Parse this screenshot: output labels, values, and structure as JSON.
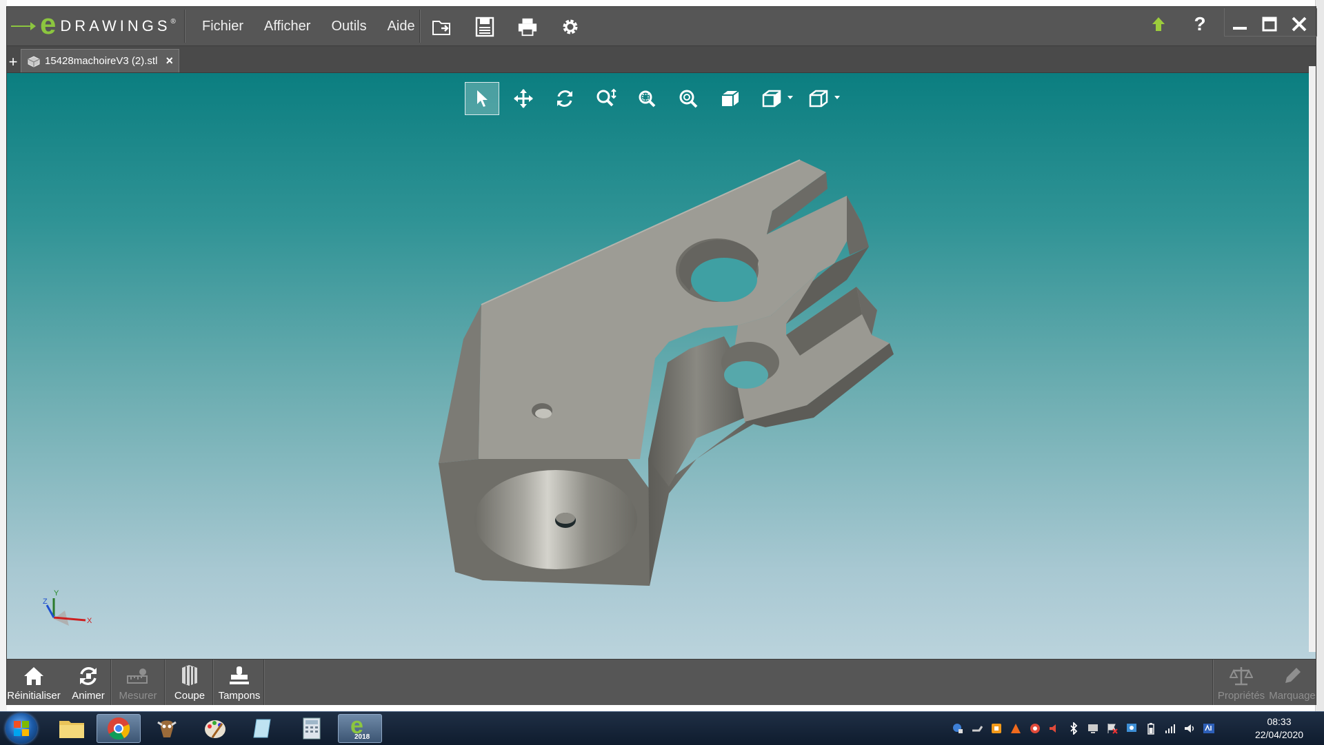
{
  "app": {
    "brand_e": "e",
    "brand_word": "DRAWINGS",
    "brand_mark": "®",
    "menu": [
      "Fichier",
      "Afficher",
      "Outils",
      "Aide"
    ],
    "toolbar_icons": [
      "open-icon",
      "save-icon",
      "print-icon",
      "settings-icon"
    ],
    "window_controls": [
      "upload-icon",
      "help-icon",
      "minimize-icon",
      "maximize-icon",
      "close-icon"
    ]
  },
  "tabs": {
    "plus": "+",
    "items": [
      {
        "label": "15428machoireV3 (2).stl",
        "close": "×"
      }
    ]
  },
  "view_toolbar": {
    "tools": [
      "select-icon",
      "pan-icon",
      "rotate-icon",
      "zoom-icon",
      "zoom-area-icon",
      "zoom-fit-icon",
      "shaded-view-icon",
      "view-orientation-icon",
      "display-style-icon"
    ],
    "active": "select-icon"
  },
  "axis": {
    "x": "X",
    "y": "Y",
    "z": "Z"
  },
  "bottom_bar": {
    "left": [
      {
        "label": "Réinitialiser",
        "icon": "home-icon",
        "enabled": true
      },
      {
        "label": "Animer",
        "icon": "animate-icon",
        "enabled": true
      },
      {
        "label": "Mesurer",
        "icon": "measure-icon",
        "enabled": false
      },
      {
        "label": "Coupe",
        "icon": "section-icon",
        "enabled": true
      },
      {
        "label": "Tampons",
        "icon": "stamp-icon",
        "enabled": true
      }
    ],
    "right": [
      {
        "label": "Propriétés",
        "icon": "balance-icon",
        "enabled": false
      },
      {
        "label": "Marquage",
        "icon": "pencil-icon",
        "enabled": false
      }
    ]
  },
  "taskbar": {
    "apps": [
      "explorer-icon",
      "chrome-icon",
      "gimp-icon",
      "paint-icon",
      "notes-icon",
      "calculator-icon",
      "edrawings-icon"
    ],
    "edrawings_badge": "2018",
    "time": "08:33",
    "date": "22/04/2020"
  },
  "colors": {
    "viewport_top": "#0b7e80",
    "viewport_bottom": "#bad3dc",
    "accent_green": "#8cc63f",
    "model_gray": "#9b9a93"
  }
}
